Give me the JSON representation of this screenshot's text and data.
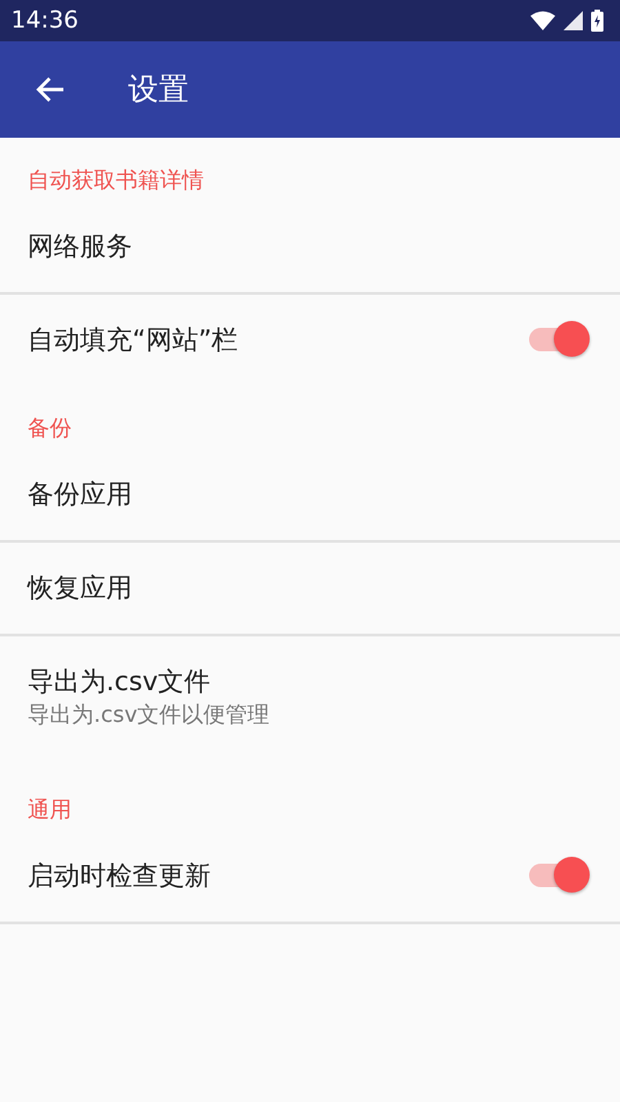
{
  "status_bar": {
    "time": "14:36"
  },
  "app_bar": {
    "title": "设置"
  },
  "sections": [
    {
      "title": "自动获取书籍详情",
      "items": [
        {
          "kind": "plain",
          "title": "网络服务"
        },
        {
          "kind": "switch",
          "title": "自动填充“网站”栏",
          "on": true
        }
      ]
    },
    {
      "title": "备份",
      "items": [
        {
          "kind": "plain",
          "title": "备份应用"
        },
        {
          "kind": "plain",
          "title": "恢复应用"
        },
        {
          "kind": "summary",
          "title": "导出为.csv文件",
          "summary": "导出为.csv文件以便管理"
        }
      ]
    },
    {
      "title": "通用",
      "items": [
        {
          "kind": "switch",
          "title": "启动时检查更新",
          "on": true
        }
      ]
    }
  ]
}
